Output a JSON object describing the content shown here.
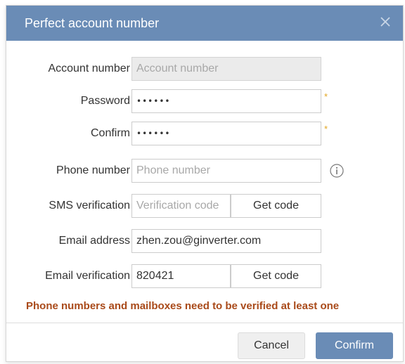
{
  "dialog": {
    "title": "Perfect account number",
    "close_icon": "close-icon"
  },
  "form": {
    "account_number": {
      "label": "Account number",
      "placeholder": "Account number",
      "value": "",
      "disabled": true
    },
    "password": {
      "label": "Password",
      "value": "••••••",
      "required_mark": "*"
    },
    "confirm": {
      "label": "Confirm",
      "value": "••••••",
      "required_mark": "*"
    },
    "phone_number": {
      "label": "Phone number",
      "placeholder": "Phone number",
      "value": "",
      "info_icon": "info-icon"
    },
    "sms_verification": {
      "label": "SMS verification",
      "placeholder": "Verification code",
      "value": "",
      "button_label": "Get code"
    },
    "email_address": {
      "label": "Email address",
      "value": "zhen.zou@ginverter.com"
    },
    "email_verification": {
      "label": "Email verification",
      "value": "820421",
      "button_label": "Get code"
    }
  },
  "warning": "Phone numbers and mailboxes need to be verified at least one",
  "footer": {
    "cancel_label": "Cancel",
    "confirm_label": "Confirm"
  },
  "colors": {
    "titlebar": "#6a8cb6",
    "primary_button": "#6a8cb6",
    "warning_text": "#a94a1a",
    "required_mark": "#e2a623"
  }
}
